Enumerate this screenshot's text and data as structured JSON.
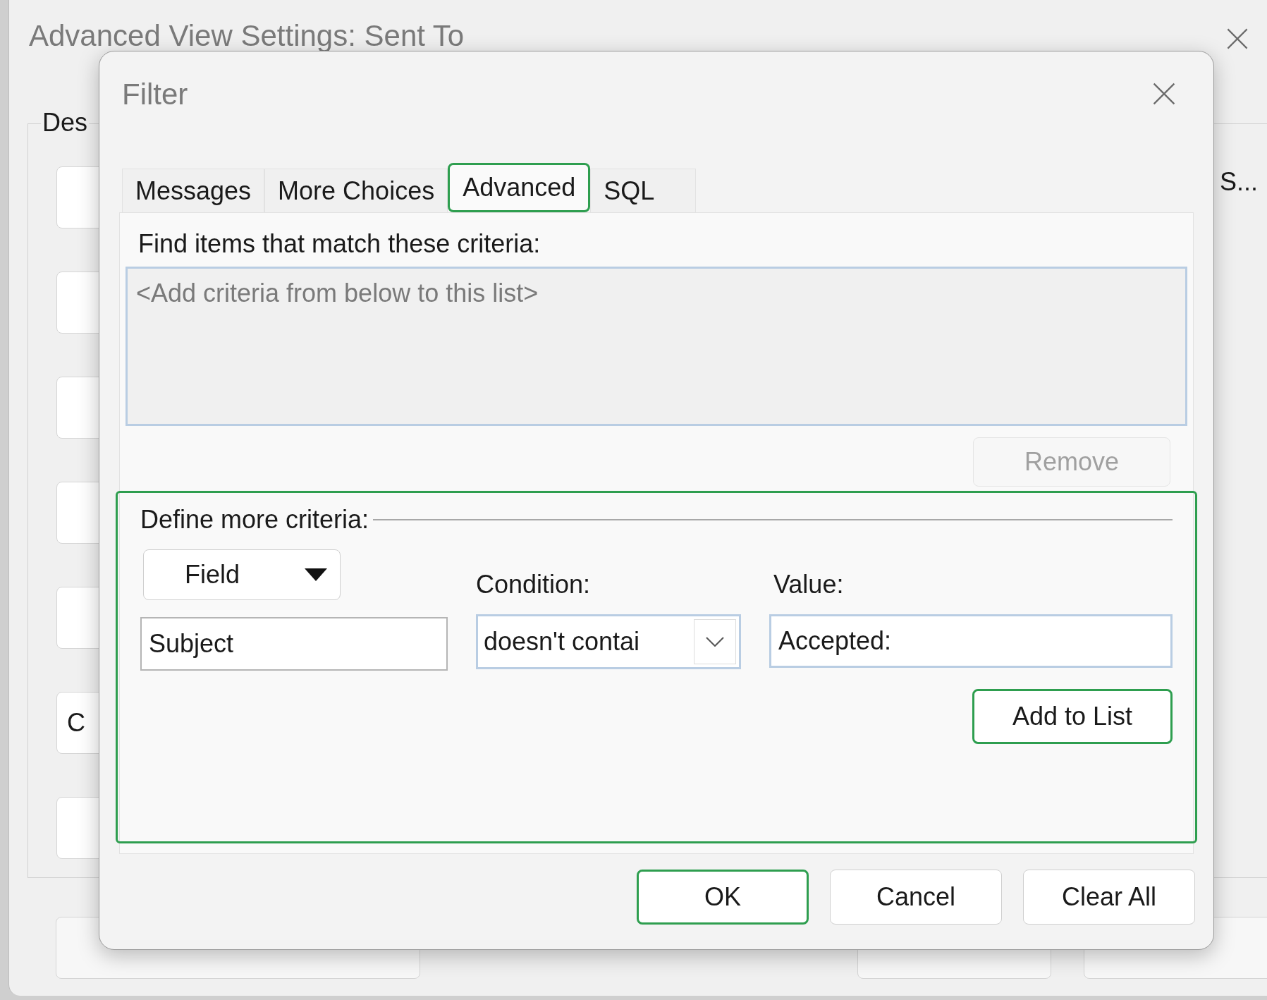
{
  "background_window": {
    "title": "Advanced View Settings: Sent To",
    "group_label": "Des",
    "side_text": "S...",
    "side_button_text": "C"
  },
  "dialog": {
    "title": "Filter",
    "tabs": [
      {
        "label": "Messages",
        "selected": false,
        "highlighted": false
      },
      {
        "label": "More Choices",
        "selected": false,
        "highlighted": false
      },
      {
        "label": "Advanced",
        "selected": true,
        "highlighted": true
      },
      {
        "label": "SQL",
        "selected": false,
        "highlighted": false
      }
    ],
    "criteria_label": "Find items that match these criteria:",
    "criteria_list": {
      "placeholder": "<Add criteria from below to this list>"
    },
    "remove_button": {
      "label": "Remove",
      "disabled": true
    },
    "define": {
      "label": "Define more criteria:",
      "highlighted": true,
      "field_button": "Field",
      "field_value": "Subject",
      "condition_label": "Condition:",
      "condition": "doesn't contai",
      "value_label": "Value:",
      "value": "Accepted:",
      "add_button": {
        "label": "Add to List",
        "highlighted": true
      }
    },
    "buttons": [
      {
        "label": "OK",
        "highlighted": true
      },
      {
        "label": "Cancel",
        "highlighted": false
      },
      {
        "label": "Clear All",
        "highlighted": false
      }
    ]
  }
}
